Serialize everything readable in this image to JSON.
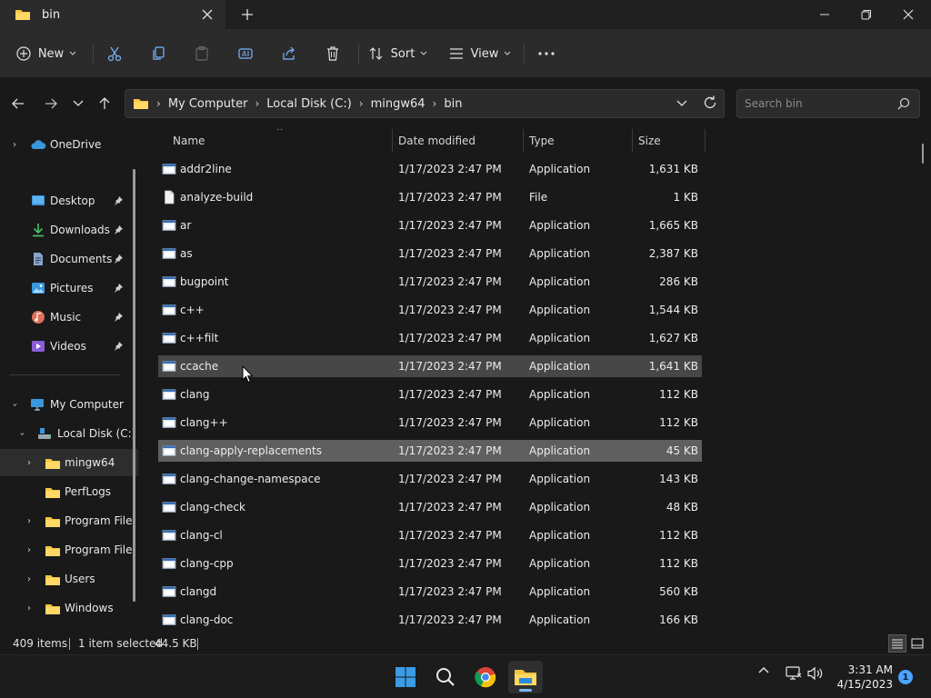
{
  "window": {
    "tab_title": "bin",
    "colors": {
      "folder": "#f5c542",
      "accent": "#4aa3ff",
      "selected_row": "#5f5f5f",
      "hover_row": "#474747"
    }
  },
  "toolbar": {
    "new_label": "New",
    "sort_label": "Sort",
    "view_label": "View",
    "icons": [
      "cut-icon",
      "copy-icon",
      "paste-icon",
      "rename-icon",
      "share-icon",
      "delete-icon",
      "more-icon"
    ]
  },
  "address": {
    "crumbs": [
      "My Computer",
      "Local Disk (C:)",
      "mingw64",
      "bin"
    ]
  },
  "search": {
    "placeholder": "Search bin"
  },
  "sidebar": {
    "onedrive": "OneDrive",
    "quick": [
      {
        "label": "Desktop",
        "icon": "desktop-icon"
      },
      {
        "label": "Downloads",
        "icon": "downloads-icon"
      },
      {
        "label": "Documents",
        "icon": "documents-icon"
      },
      {
        "label": "Pictures",
        "icon": "pictures-icon"
      },
      {
        "label": "Music",
        "icon": "music-icon"
      },
      {
        "label": "Videos",
        "icon": "videos-icon"
      }
    ],
    "computer": "My Computer",
    "drive": "Local Disk (C:)",
    "folders": [
      "mingw64",
      "PerfLogs",
      "Program File",
      "Program File",
      "Users",
      "Windows"
    ]
  },
  "columns": {
    "name": "Name",
    "date": "Date modified",
    "type": "Type",
    "size": "Size"
  },
  "files": [
    {
      "name": "addr2line",
      "date": "1/17/2023 2:47 PM",
      "type": "Application",
      "size": "1,631 KB",
      "kind": "app"
    },
    {
      "name": "analyze-build",
      "date": "1/17/2023 2:47 PM",
      "type": "File",
      "size": "1 KB",
      "kind": "file"
    },
    {
      "name": "ar",
      "date": "1/17/2023 2:47 PM",
      "type": "Application",
      "size": "1,665 KB",
      "kind": "app"
    },
    {
      "name": "as",
      "date": "1/17/2023 2:47 PM",
      "type": "Application",
      "size": "2,387 KB",
      "kind": "app"
    },
    {
      "name": "bugpoint",
      "date": "1/17/2023 2:47 PM",
      "type": "Application",
      "size": "286 KB",
      "kind": "app"
    },
    {
      "name": "c++",
      "date": "1/17/2023 2:47 PM",
      "type": "Application",
      "size": "1,544 KB",
      "kind": "app"
    },
    {
      "name": "c++filt",
      "date": "1/17/2023 2:47 PM",
      "type": "Application",
      "size": "1,627 KB",
      "kind": "app"
    },
    {
      "name": "ccache",
      "date": "1/17/2023 2:47 PM",
      "type": "Application",
      "size": "1,641 KB",
      "kind": "app",
      "state": "hover"
    },
    {
      "name": "clang",
      "date": "1/17/2023 2:47 PM",
      "type": "Application",
      "size": "112 KB",
      "kind": "app"
    },
    {
      "name": "clang++",
      "date": "1/17/2023 2:47 PM",
      "type": "Application",
      "size": "112 KB",
      "kind": "app"
    },
    {
      "name": "clang-apply-replacements",
      "date": "1/17/2023 2:47 PM",
      "type": "Application",
      "size": "45 KB",
      "kind": "app",
      "state": "selected"
    },
    {
      "name": "clang-change-namespace",
      "date": "1/17/2023 2:47 PM",
      "type": "Application",
      "size": "143 KB",
      "kind": "app"
    },
    {
      "name": "clang-check",
      "date": "1/17/2023 2:47 PM",
      "type": "Application",
      "size": "48 KB",
      "kind": "app"
    },
    {
      "name": "clang-cl",
      "date": "1/17/2023 2:47 PM",
      "type": "Application",
      "size": "112 KB",
      "kind": "app"
    },
    {
      "name": "clang-cpp",
      "date": "1/17/2023 2:47 PM",
      "type": "Application",
      "size": "112 KB",
      "kind": "app"
    },
    {
      "name": "clangd",
      "date": "1/17/2023 2:47 PM",
      "type": "Application",
      "size": "560 KB",
      "kind": "app"
    },
    {
      "name": "clang-doc",
      "date": "1/17/2023 2:47 PM",
      "type": "Application",
      "size": "166 KB",
      "kind": "app"
    }
  ],
  "status": {
    "items": "409 items",
    "selection": "1 item selected",
    "selection_size": "44.5 KB"
  },
  "taskbar": {
    "apps": [
      "start-icon",
      "search-icon",
      "chrome-icon",
      "file-explorer-icon"
    ],
    "time": "3:31 AM",
    "date": "4/15/2023",
    "notifications": "1"
  }
}
